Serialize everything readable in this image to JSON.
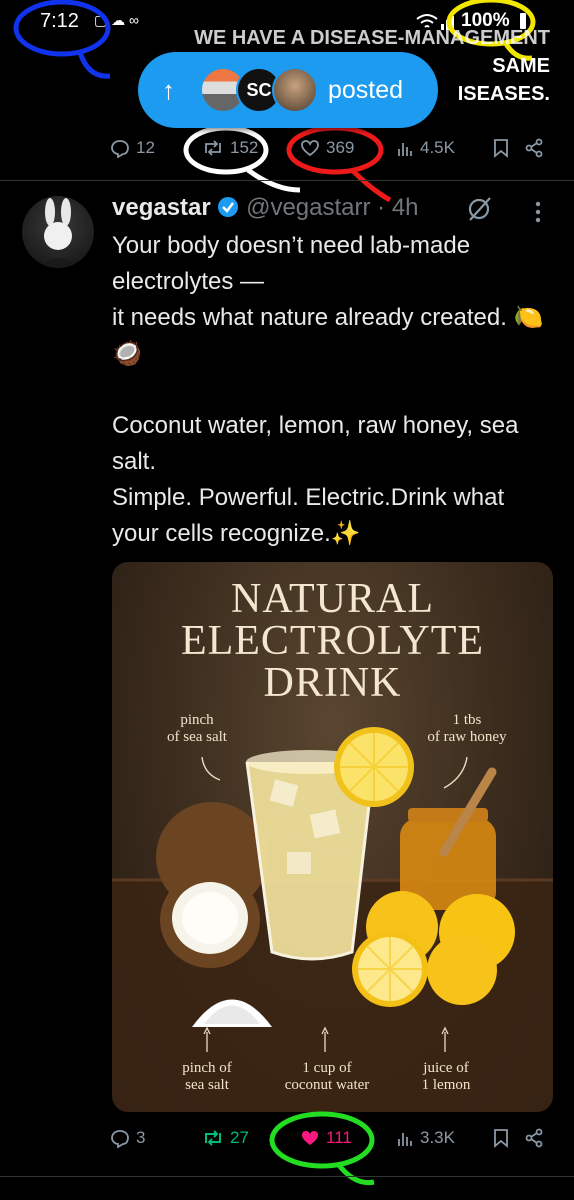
{
  "status_bar": {
    "time": "7:12",
    "battery": "100%"
  },
  "previous_tweet": {
    "text_lines": [
      "WE HAVE A DISEASE-MANAGEMENT",
      "SAME",
      "ISEASES."
    ],
    "posted_label": "posted",
    "actions": {
      "replies": "12",
      "reposts": "152",
      "likes": "369",
      "views": "4.5K"
    }
  },
  "tweet": {
    "display_name": "vegastar",
    "handle": "@vegastarr",
    "time": "· 4h",
    "text": "Your body doesn’t need lab-made electrolytes —\nit needs what nature already created. 🍋🥥\n\nCoconut water, lemon, raw honey, sea salt.\nSimple. Powerful. Electric.Drink what your cells recognize.✨",
    "media": {
      "title": "NATURAL\nELECTROLYTE\nDRINK",
      "label_top_left": "pinch\nof sea salt",
      "label_top_right": "1 tbs\nof raw honey",
      "label_bottom_1": "pinch of\nsea salt",
      "label_bottom_2": "1 cup of\ncoconut water",
      "label_bottom_3": "juice of\n1 lemon"
    },
    "actions": {
      "replies": "3",
      "reposts": "27",
      "likes": "111",
      "views": "3.3K"
    }
  },
  "colors": {
    "accent_blue": "#1d9bf0",
    "repost_green": "#00ba7c",
    "like_pink": "#f91880",
    "muted": "#8b98a5"
  },
  "icons": [
    "reply-icon",
    "repost-icon",
    "like-icon",
    "views-icon",
    "bookmark-icon",
    "share-icon",
    "verified-icon",
    "grok-icon",
    "more-icon"
  ]
}
